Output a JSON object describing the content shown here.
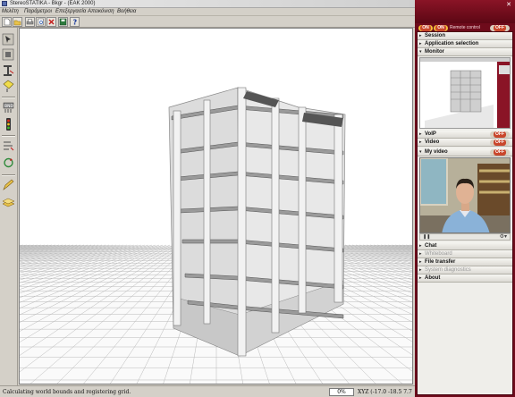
{
  "window": {
    "title": "StereoSTATIKA - Bkgr - (EAK 2000)"
  },
  "menu": [
    "Μελέτη",
    "Παράμετροι",
    "Επεξεργασία",
    "Απεικόνιση",
    "Βοήθεια"
  ],
  "toolbar": {
    "buttons": [
      "new-file-icon",
      "open-folder-icon",
      "print-icon",
      "print-preview-icon",
      "delete-icon",
      "save-icon",
      "help-icon"
    ]
  },
  "left_tools": [
    "select-icon",
    "move-icon",
    "column-icon",
    "section-icon",
    "traffic-light-icon",
    "calculate-icon",
    "beam-icon",
    "rotate-icon",
    "edit-icon",
    "layers-icon"
  ],
  "viewport": {
    "content": "3D building frame model"
  },
  "status": {
    "message": "Calculating world bounds and registering grid.",
    "progress": "0%",
    "coords": "XYZ (-17.0 -18.5 7.7"
  },
  "panel": {
    "remote_control_label": "Remote control",
    "top_toggles": [
      {
        "state": "on",
        "label": "ON"
      },
      {
        "state": "on",
        "label": "ON"
      },
      {
        "state": "off",
        "label": "OFF"
      }
    ],
    "sections": {
      "session": "Session",
      "application_selection": "Application selection",
      "monitor": "Monitor",
      "voip": "VoIP",
      "video": "Video",
      "my_video": "My video",
      "chat": "Chat",
      "whiteboard": "Whiteboard",
      "file_transfer": "File transfer",
      "system_diagnostics": "System diagnostics",
      "about": "About"
    },
    "toggles": {
      "voip": "OFF",
      "video": "OFF",
      "my_video": "OFF"
    }
  },
  "colors": {
    "panel_accent": "#6e0b1b",
    "viewport_bg": "#ffffff",
    "chrome": "#d4d0c8"
  }
}
